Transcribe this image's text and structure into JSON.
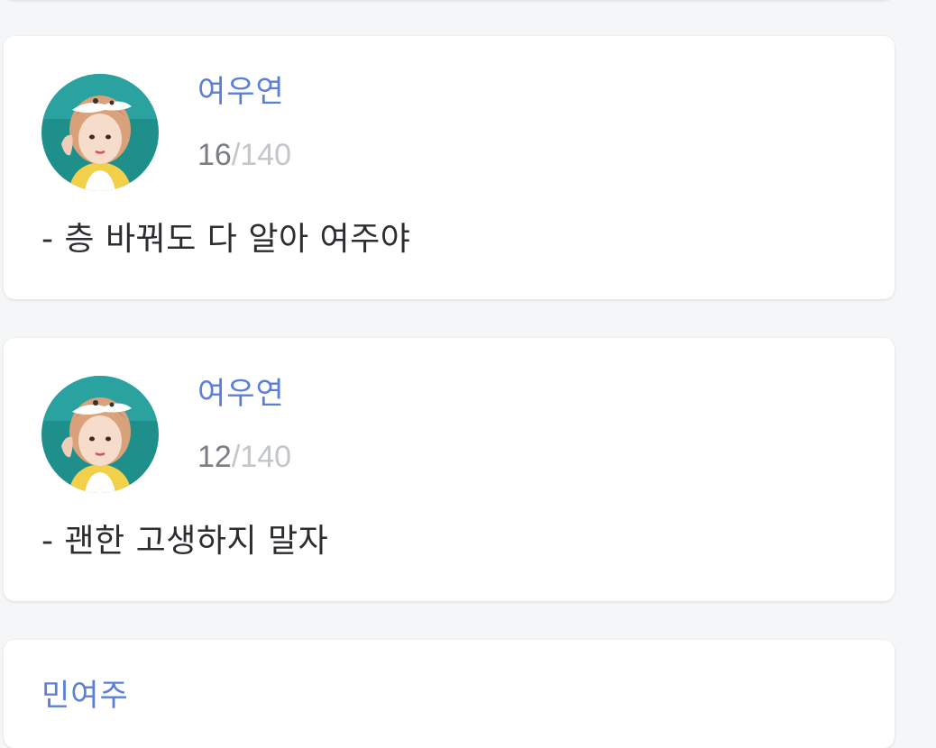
{
  "posts": [
    {
      "author": "여우연",
      "counter_used": "16",
      "counter_sep": "/",
      "counter_max": "140",
      "content": "- 층 바꿔도 다 알아 여주야"
    },
    {
      "author": "여우연",
      "counter_used": "12",
      "counter_sep": "/",
      "counter_max": "140",
      "content": "- 괜한 고생하지 말자"
    },
    {
      "author": "민여주"
    }
  ],
  "colors": {
    "author": "#5b7fd9",
    "counter_used": "#7a7e83",
    "counter_max": "#c2c5c9",
    "text": "#2b2d30",
    "background": "#f4f6f8",
    "card": "#ffffff",
    "avatar_bg": "#1f8f8c"
  },
  "icons": {
    "avatar": "profile-photo-avatar-icon"
  }
}
